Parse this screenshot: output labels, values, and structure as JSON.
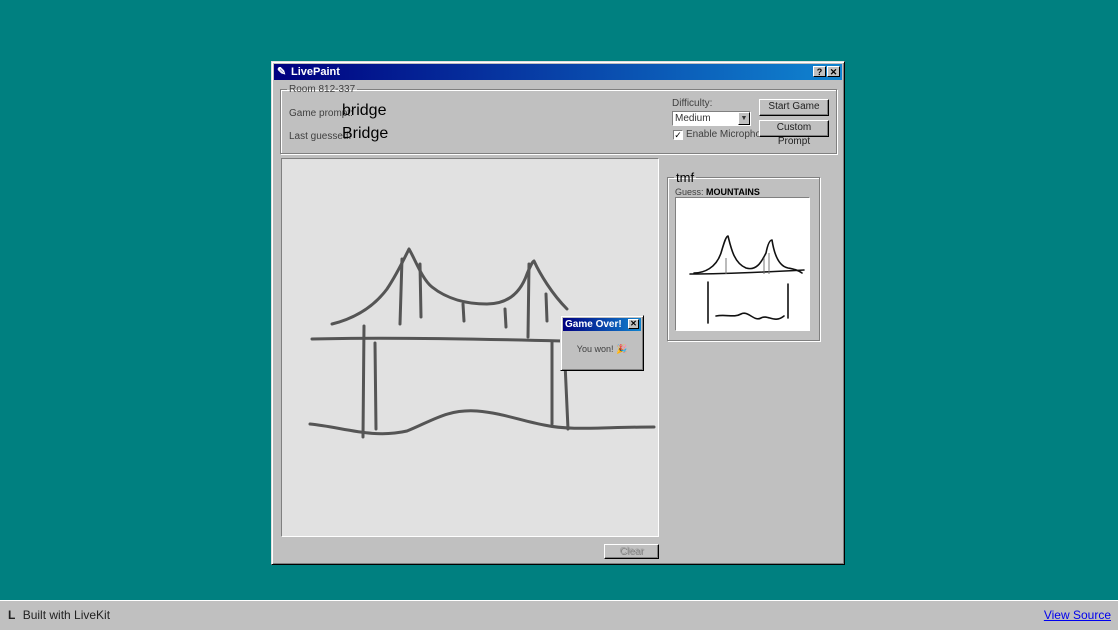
{
  "window": {
    "title": "LivePaint",
    "icon": "pencil-icon",
    "help_label": "?",
    "close_label": "✕"
  },
  "room": {
    "label": "Room 812-337",
    "prompt_label": "Game prompt:",
    "prompt_value": "bridge",
    "guess_label": "Last guessed:",
    "guess_value": "Bridge"
  },
  "controls": {
    "difficulty_label": "Difficulty:",
    "difficulty_value": "Medium",
    "mic_label": "Enable Microphone",
    "mic_checked": true,
    "start_label": "Start Game",
    "custom_label": "Custom Prompt"
  },
  "canvas": {
    "clear_label": "Clear",
    "background": "#e1e1e1",
    "stroke_color": "#555555"
  },
  "dialog": {
    "title": "Game Over!",
    "message": "You won!",
    "icon": "party-popper-icon",
    "emoji": "🎉"
  },
  "player": {
    "name": "tmf",
    "guess_label": "Guess:",
    "guess_value": "MOUNTAINS"
  },
  "footer": {
    "brand_label": "Built with LiveKit",
    "logo_glyph": "L",
    "source_link": "View Source"
  },
  "colors": {
    "desktop": "#008080",
    "window": "#c0c0c0",
    "titlebar": "#000080"
  }
}
